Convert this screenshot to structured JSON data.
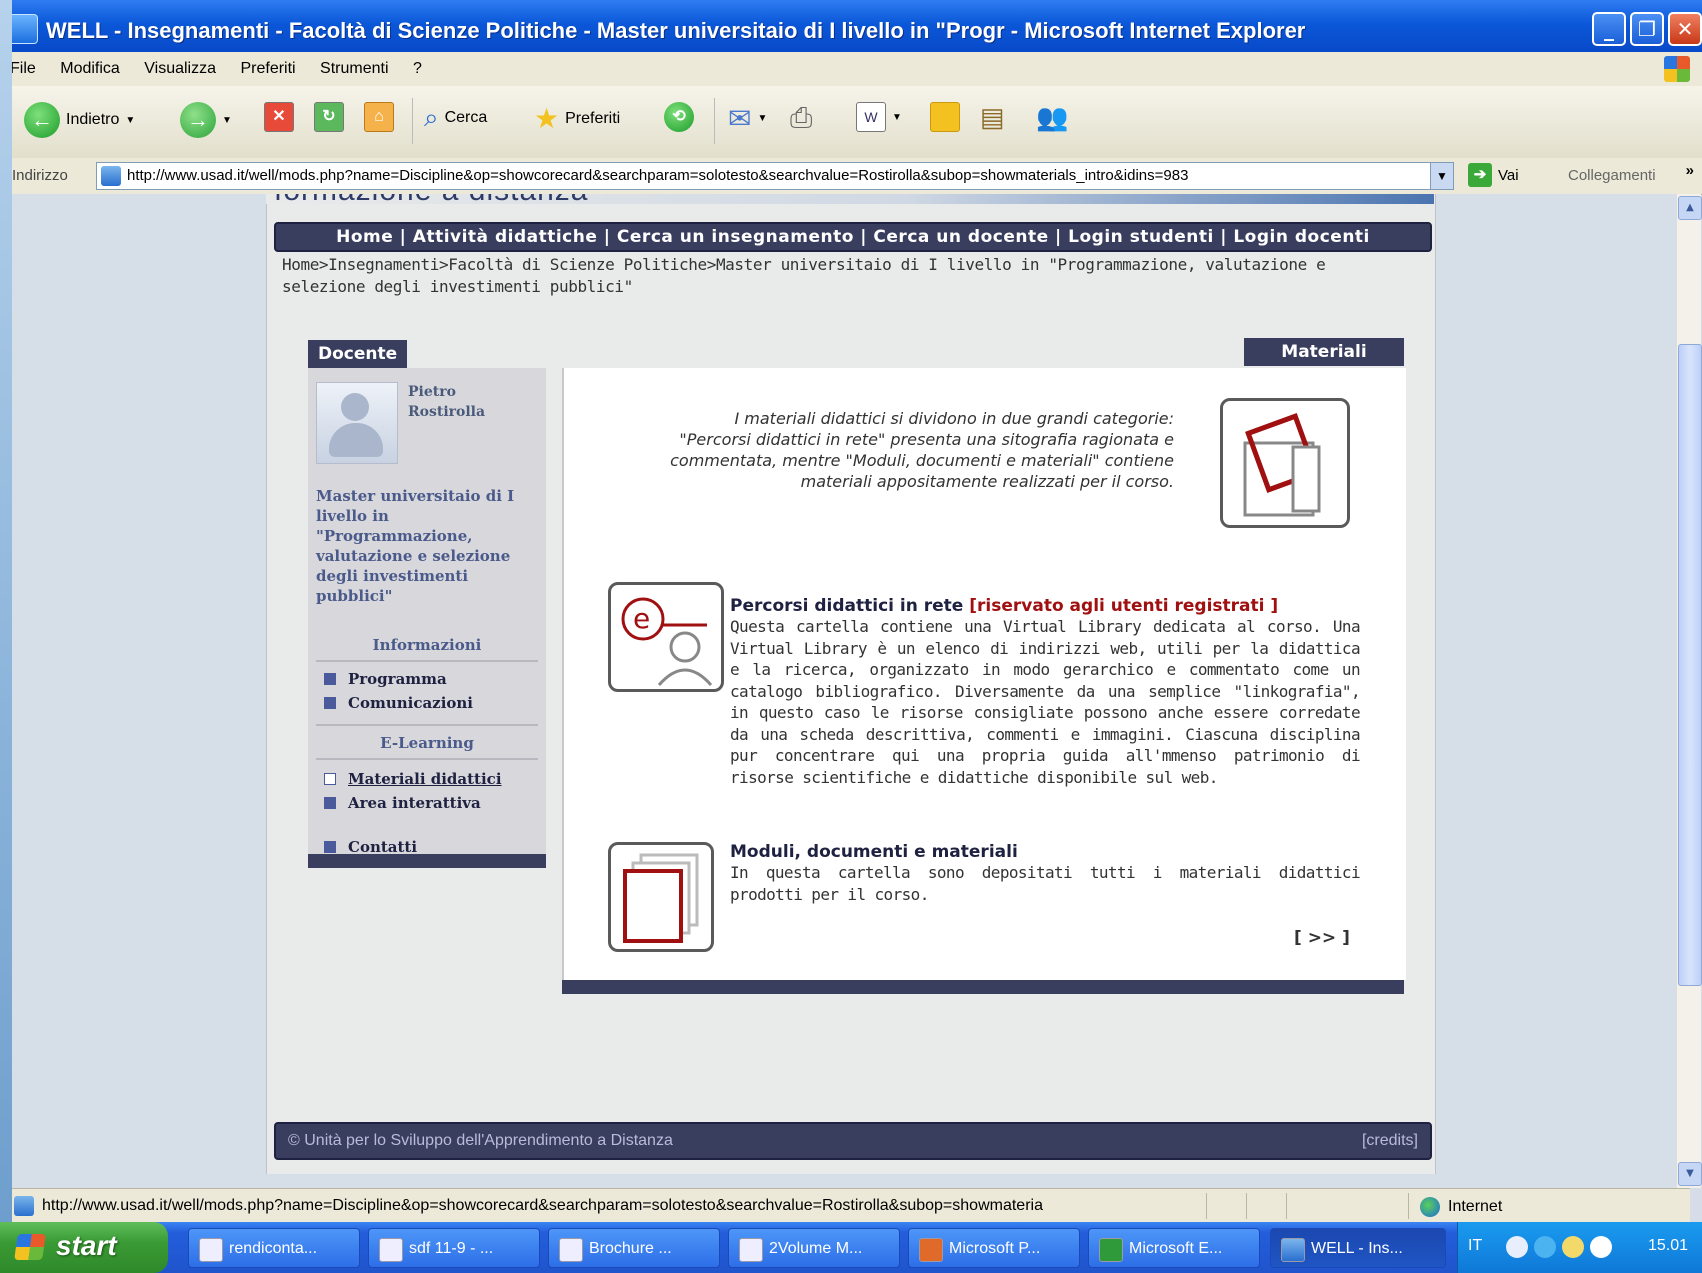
{
  "window": {
    "title": "WELL - Insegnamenti - Facoltà di Scienze Politiche - Master universitaio di I livello in \"Progr - Microsoft Internet Explorer",
    "buttons": [
      "minimize-icon",
      "maximize-icon",
      "close-icon"
    ]
  },
  "menu": [
    "File",
    "Modifica",
    "Visualizza",
    "Preferiti",
    "Strumenti",
    "?"
  ],
  "toolbar": {
    "back_label": "Indietro",
    "search_label": "Cerca",
    "favorites_label": "Preferiti"
  },
  "address": {
    "label": "Indirizzo",
    "url": "http://www.usad.it/well/mods.php?name=Discipline&op=showcorecard&searchparam=solotesto&searchvalue=Rostirolla&subop=showmaterials_intro&idins=983",
    "go_label": "Vai",
    "links_label": "Collegamenti",
    "more": "»"
  },
  "page": {
    "logo_text": "formazione a distanza",
    "topnav": "Home | Attività didattiche | Cerca un insegnamento | Cerca un docente | Login studenti | Login docenti",
    "breadcrumb": "Home>Insegnamenti>Facoltà di Scienze Politiche>Master universitaio di I livello in \"Programmazione, valutazione e selezione degli investimenti pubblici\"",
    "docente": {
      "tab": "Docente",
      "name_first": "Pietro",
      "name_last": "Rostirolla",
      "course": "Master universitaio di I livello in \"Programmazione, valutazione e selezione degli investimenti pubblici\"",
      "section_info": "Informazioni",
      "programma": "Programma",
      "comunicazioni": "Comunicazioni",
      "section_elearning": "E-Learning",
      "materiali": "Materiali didattici",
      "area": "Area interattiva",
      "contatti": "Contatti"
    },
    "materiali": {
      "tab": "Materiali",
      "intro": "I materiali didattici si dividono in due grandi categorie: \"Percorsi didattici in rete\" presenta una sitografia ragionata e commentata, mentre \"Moduli, documenti e materiali\" contiene materiali appositamente realizzati per il corso.",
      "sec1_title": "Percorsi didattici in rete",
      "sec1_restricted": "[riservato agli utenti registrati ]",
      "sec1_body": "Questa cartella contiene una Virtual Library dedicata al corso. Una Virtual Library è un elenco di indirizzi web, utili per la didattica e la ricerca, organizzato in modo gerarchico e commentato come un catalogo bibliografico. Diversamente da una semplice \"linkografia\", in questo caso le risorse consigliate possono anche essere corredate da una scheda descrittiva, commenti e immagini. Ciascuna disciplina pur concentrare qui una propria guida all'mmenso patrimonio di risorse scientifiche e didattiche disponibile sul web.",
      "sec2_title": "Moduli, documenti e materiali",
      "sec2_body": "In questa cartella sono depositati tutti i materiali didattici prodotti per il corso.",
      "more": "[ >> ]"
    },
    "footer_left": "© Unità per lo Sviluppo dell'Apprendimento a Distanza",
    "footer_right": "[credits]"
  },
  "statusbar": {
    "text": "http://www.usad.it/well/mods.php?name=Discipline&op=showcorecard&searchparam=solotesto&searchvalue=Rostirolla&subop=showmateria",
    "zone": "Internet"
  },
  "taskbar": {
    "start": "start",
    "tasks": [
      "rendiconta...",
      "sdf 11-9 - ...",
      "Brochure ...",
      "2Volume M...",
      "Microsoft P...",
      "Microsoft E...",
      "WELL - Ins..."
    ],
    "lang": "IT",
    "clock": "15.01"
  }
}
